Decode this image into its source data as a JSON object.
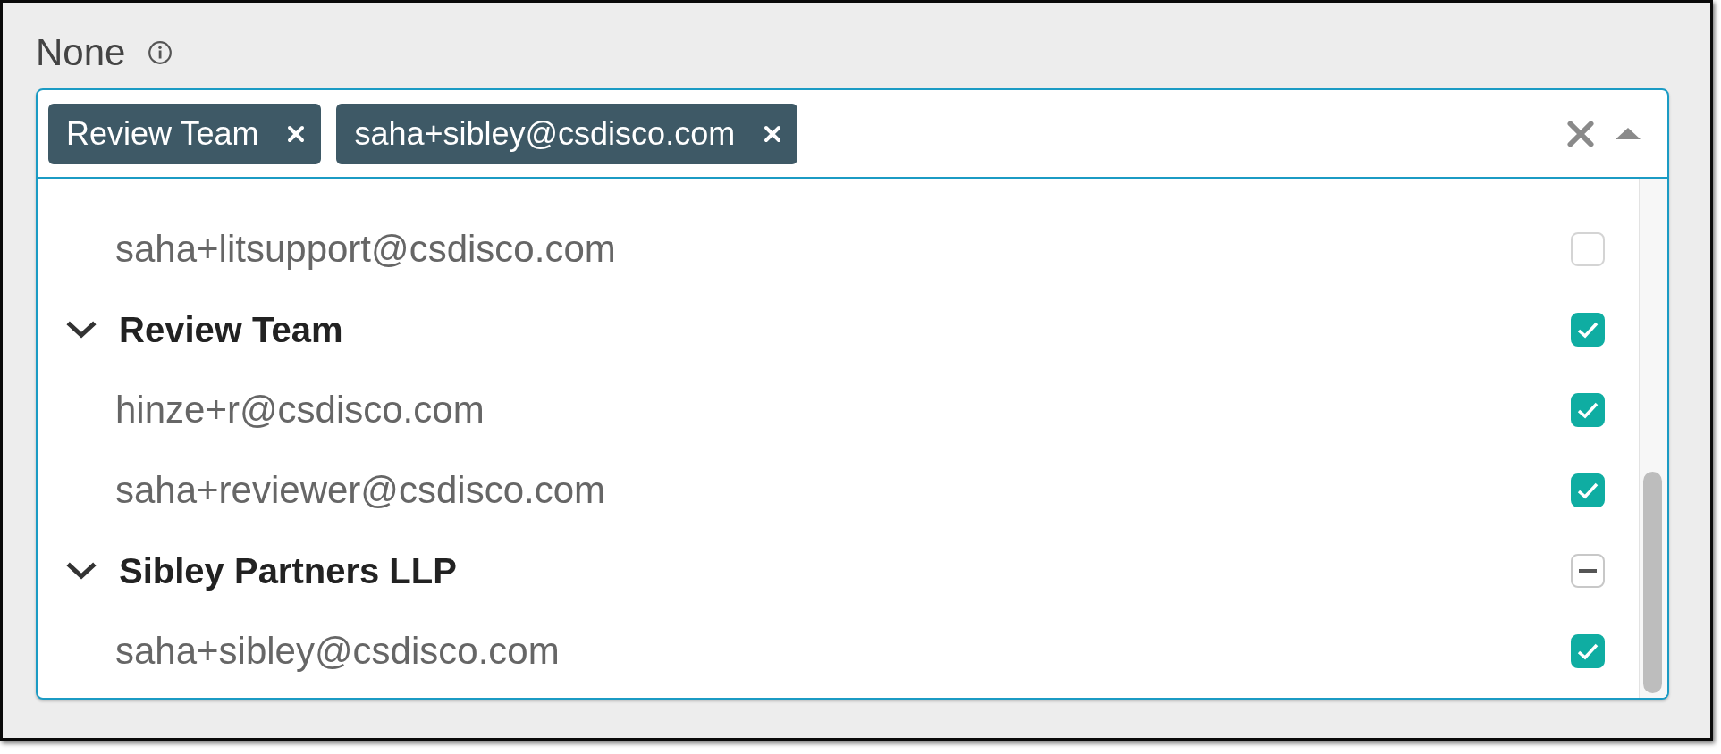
{
  "field": {
    "label": "None",
    "expanded": true,
    "tags": [
      {
        "label": "Review Team"
      },
      {
        "label": "saha+sibley@csdisco.com"
      }
    ]
  },
  "options": [
    {
      "kind": "member",
      "label": "saha+litsupport@csdisco.com",
      "checked": false,
      "partial": false
    },
    {
      "kind": "group",
      "label": "Review Team",
      "expanded": true,
      "checked": true,
      "partial": false,
      "children": [
        {
          "kind": "member",
          "label": "hinze+r@csdisco.com",
          "checked": true,
          "partial": false
        },
        {
          "kind": "member",
          "label": "saha+reviewer@csdisco.com",
          "checked": true,
          "partial": false
        }
      ]
    },
    {
      "kind": "group",
      "label": "Sibley Partners LLP",
      "expanded": true,
      "checked": false,
      "partial": true,
      "children": [
        {
          "kind": "member",
          "label": "saha+sibley@csdisco.com",
          "checked": true,
          "partial": false
        }
      ]
    }
  ]
}
